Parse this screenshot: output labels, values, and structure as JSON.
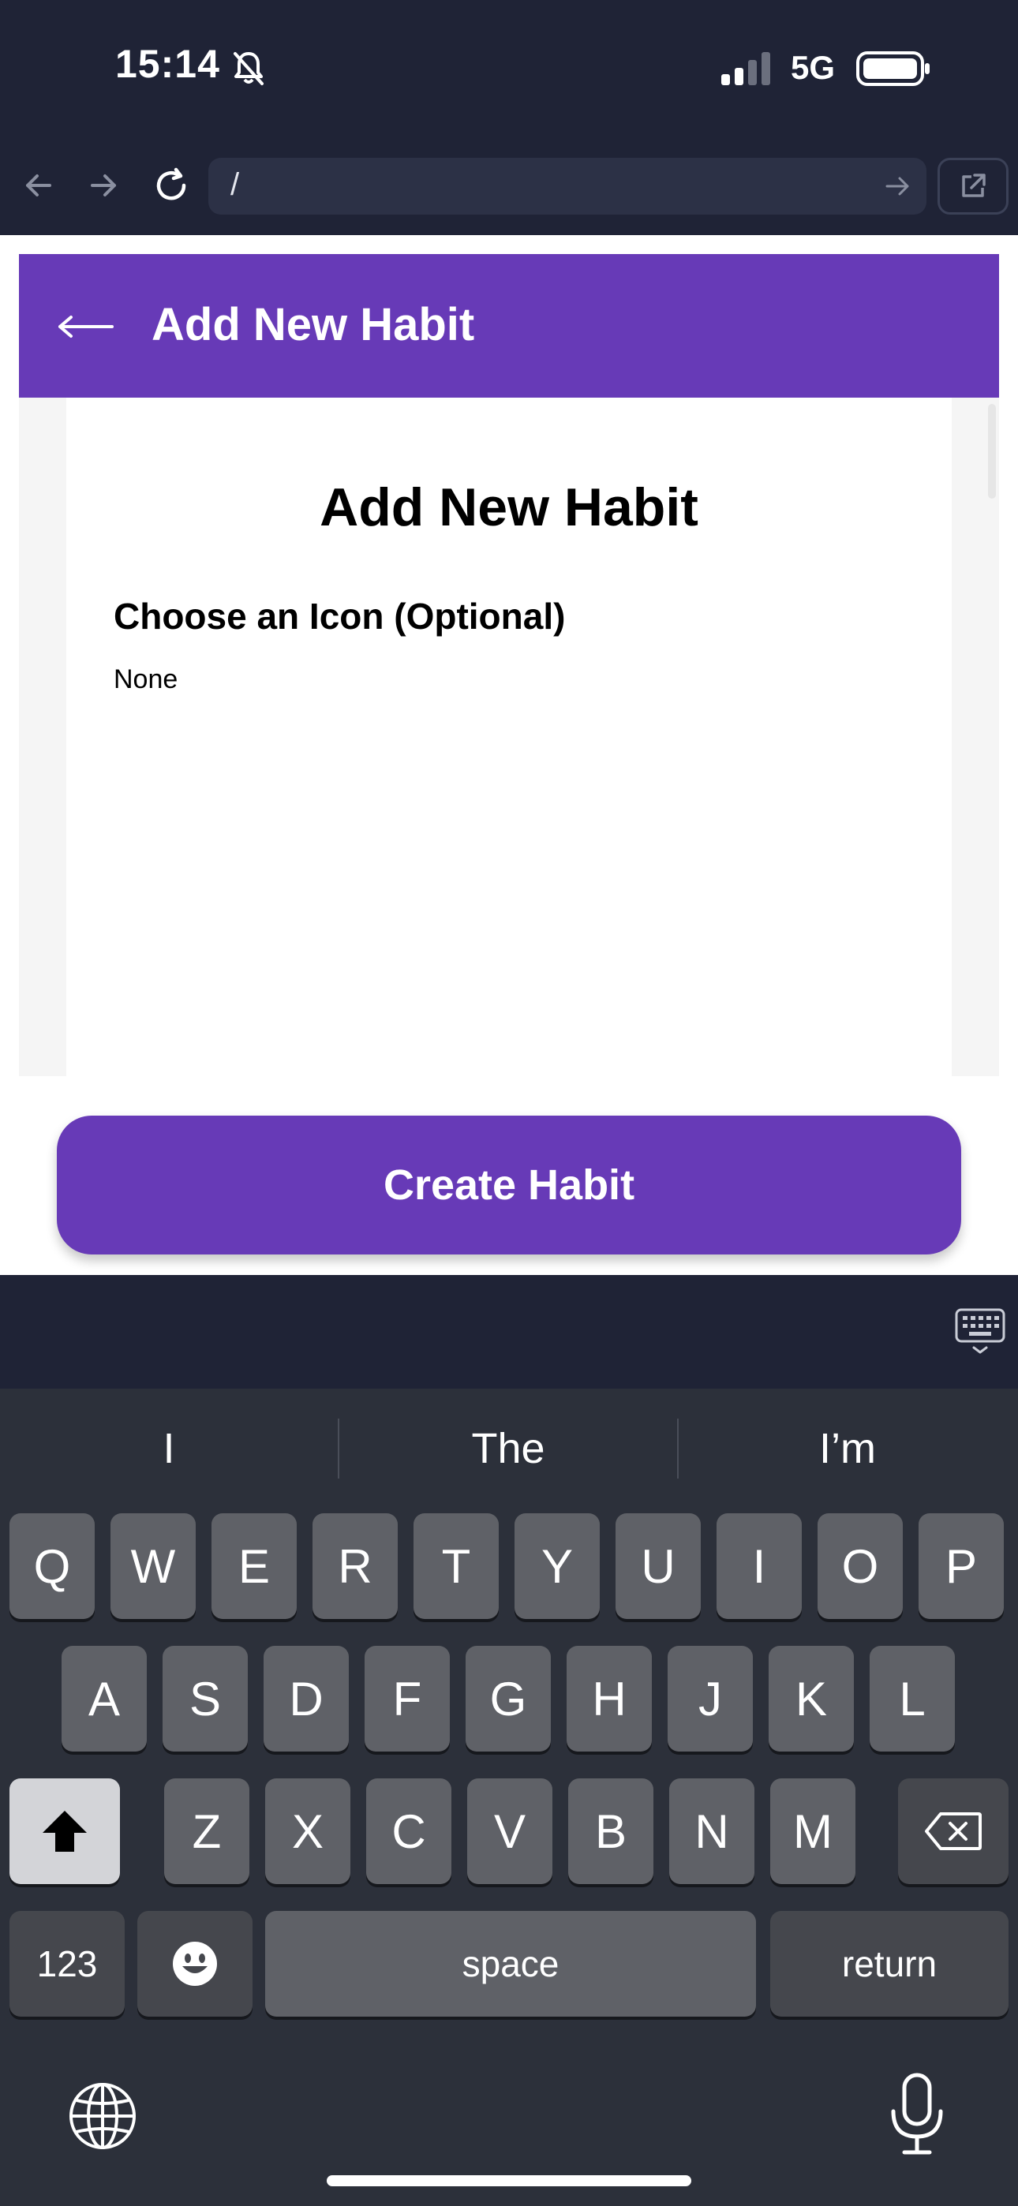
{
  "status_bar": {
    "time": "15:14",
    "network": "5G",
    "icons": [
      "bell-slash-icon",
      "signal-icon",
      "battery-icon"
    ]
  },
  "browser": {
    "url": "/",
    "icons": [
      "back-arrow-icon",
      "forward-arrow-icon",
      "reload-icon",
      "go-arrow-icon",
      "external-link-icon"
    ]
  },
  "app_header": {
    "back_icon": "left-arrow-icon",
    "title": "Add New Habit"
  },
  "form": {
    "title": "Add New Habit",
    "icon_section_heading": "Choose an Icon (Optional)",
    "icon_selected": "None",
    "submit_label": "Create Habit"
  },
  "keyboard": {
    "suggestions": [
      "I",
      "The",
      "I’m"
    ],
    "row1": [
      "Q",
      "W",
      "E",
      "R",
      "T",
      "Y",
      "U",
      "I",
      "O",
      "P"
    ],
    "row2": [
      "A",
      "S",
      "D",
      "F",
      "G",
      "H",
      "J",
      "K",
      "L"
    ],
    "row3": [
      "Z",
      "X",
      "C",
      "V",
      "B",
      "N",
      "M"
    ],
    "numbers_label": "123",
    "space_label": "space",
    "return_label": "return",
    "icons": [
      "shift-icon",
      "delete-icon",
      "emoji-icon",
      "globe-icon",
      "microphone-icon",
      "keyboard-dismiss-icon"
    ]
  },
  "colors": {
    "accent": "#673ab7",
    "chrome_background": "#1f2336",
    "keyboard_background": "#2c303a",
    "key_color": "#5f6167"
  }
}
